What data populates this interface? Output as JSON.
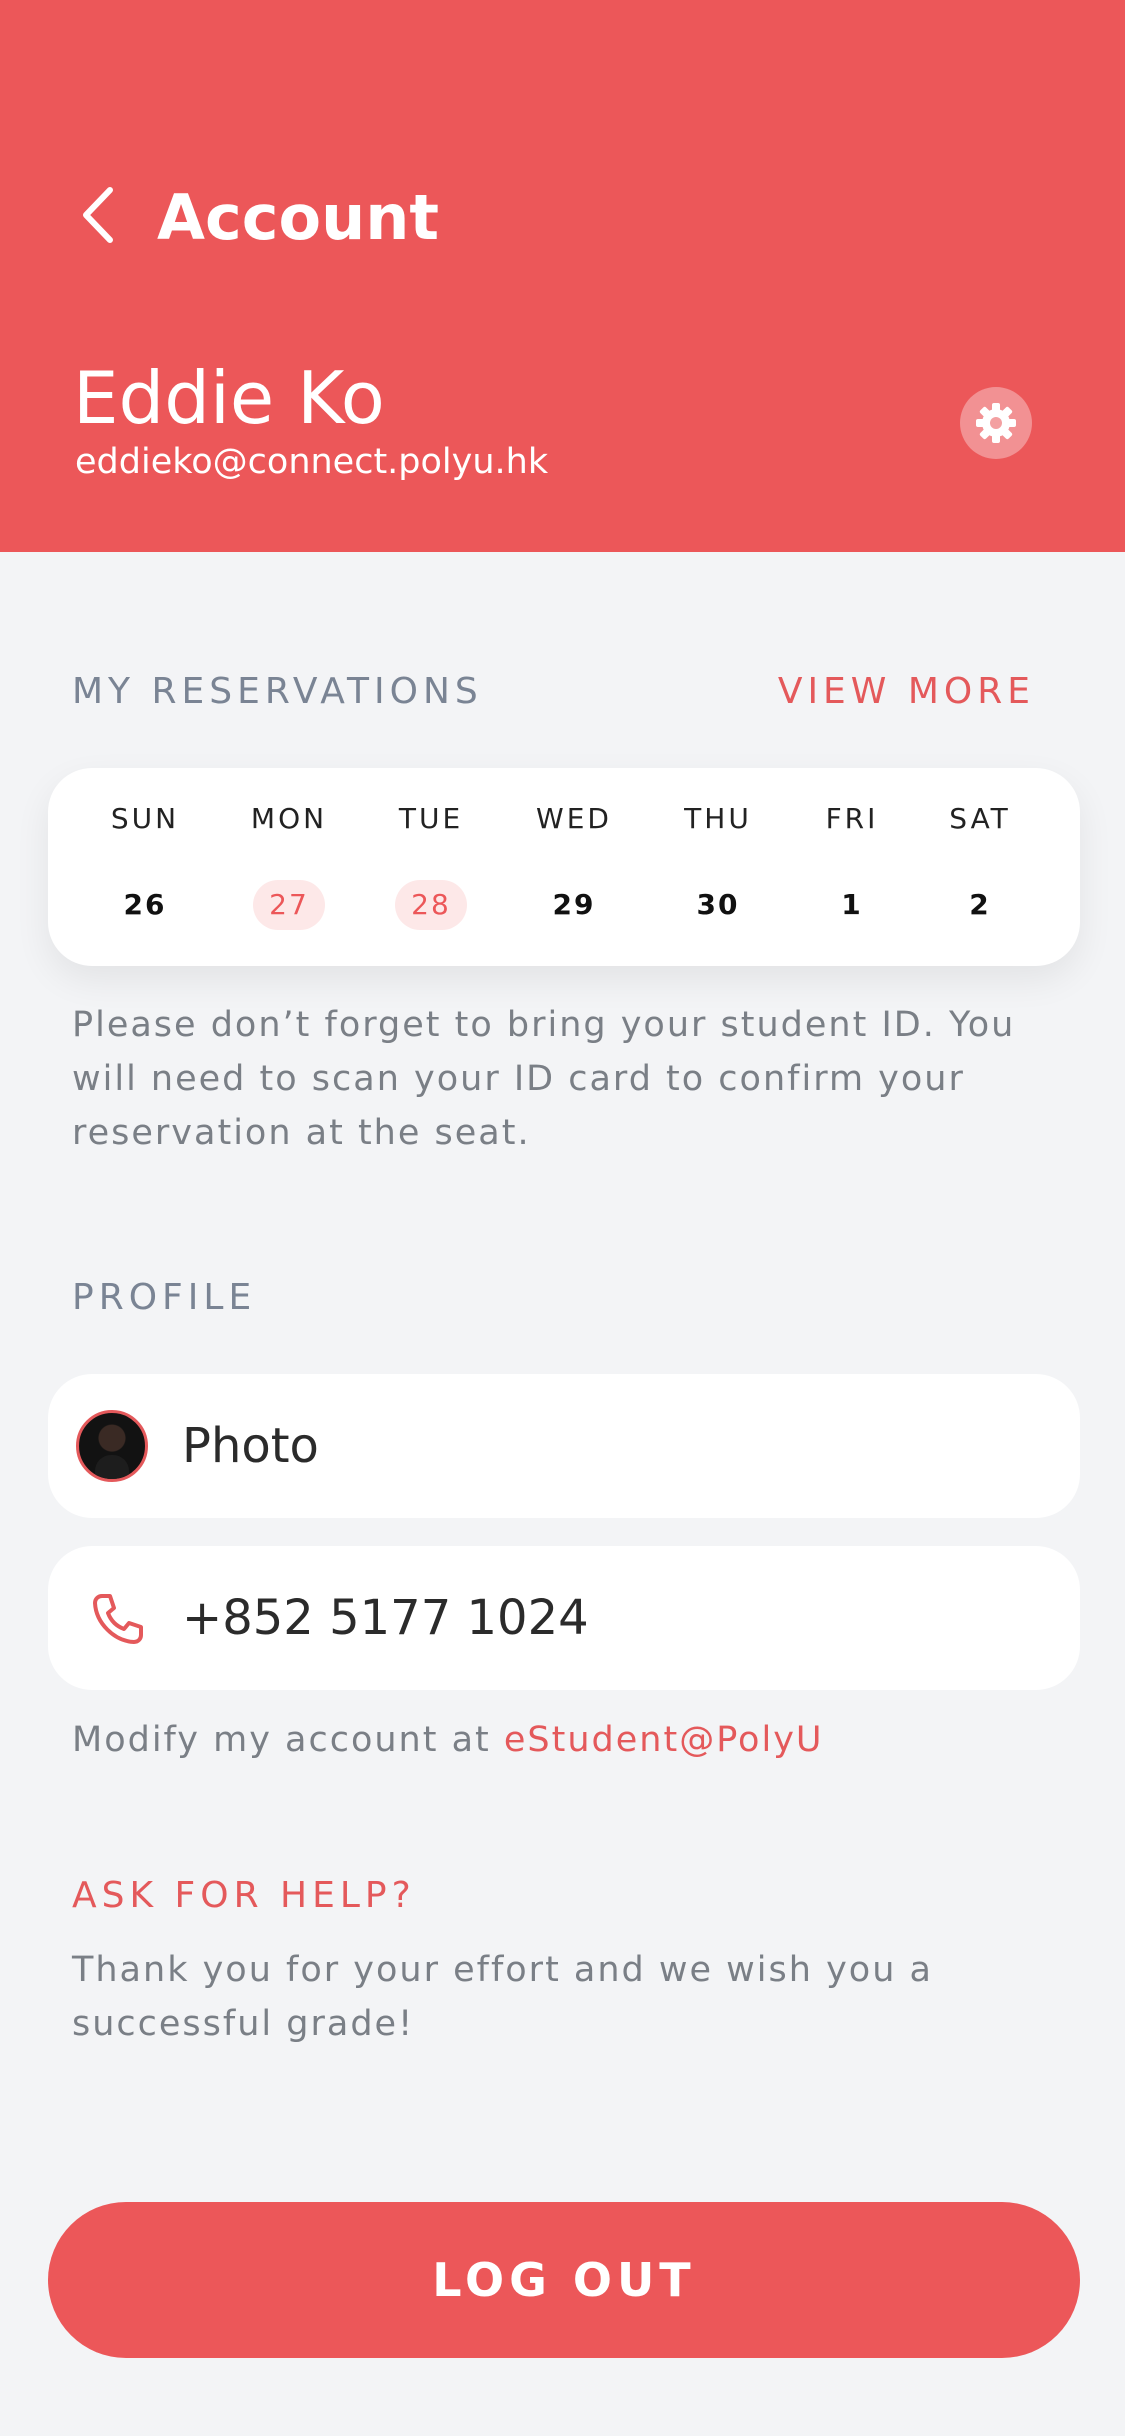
{
  "header": {
    "title": "Account",
    "back_icon": "chevron-left-icon",
    "user_name": "Eddie Ko",
    "user_email": "eddieko@connect.polyu.hk",
    "settings_icon": "gear-icon",
    "background_color": "#ec5759"
  },
  "reservations": {
    "label": "MY RESERVATIONS",
    "view_more": "VIEW MORE",
    "days": [
      {
        "name": "SUN",
        "number": "26",
        "reserved": false
      },
      {
        "name": "MON",
        "number": "27",
        "reserved": true
      },
      {
        "name": "TUE",
        "number": "28",
        "reserved": true
      },
      {
        "name": "WED",
        "number": "29",
        "reserved": false
      },
      {
        "name": "THU",
        "number": "30",
        "reserved": false
      },
      {
        "name": "FRI",
        "number": "1",
        "reserved": false
      },
      {
        "name": "SAT",
        "number": "2",
        "reserved": false
      }
    ],
    "note_lines": [
      "Please don’t forget to bring your student ID. You",
      "will need to scan your ID card to confirm your",
      "reservation at the seat."
    ]
  },
  "profile": {
    "label": "PROFILE",
    "photo_label": "Photo",
    "phone": "+852 5177 1024",
    "phone_icon": "phone-icon",
    "modify_prefix": "Modify my account at ",
    "modify_link": "eStudent@PolyU"
  },
  "help": {
    "label": "ASK FOR HELP?",
    "text_lines": [
      "Thank you for your effort and we wish you a",
      "successful grade!"
    ]
  },
  "logout_label": "LOG OUT",
  "accent_color": "#e4595b"
}
